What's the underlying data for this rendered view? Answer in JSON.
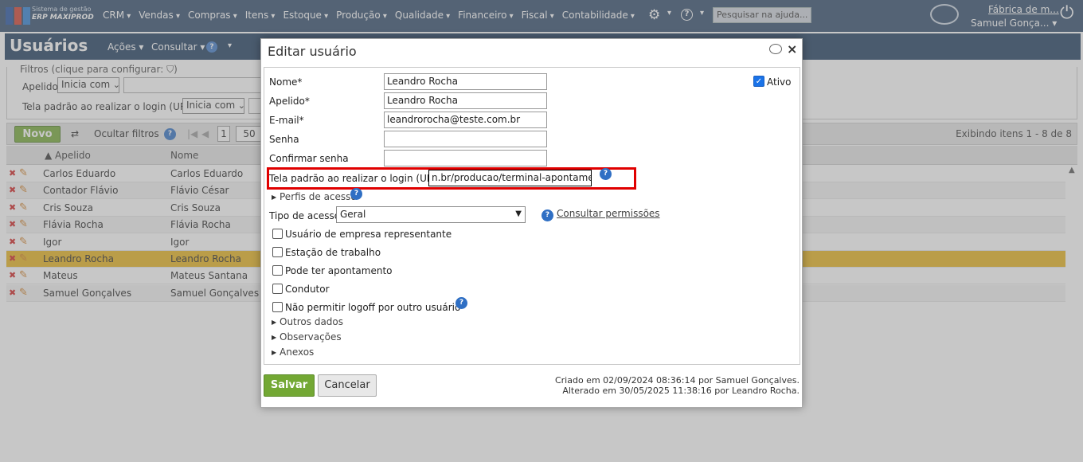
{
  "topbar": {
    "brand_line1": "Sistema de gestão",
    "brand_line2": "ERP MAXIPROD",
    "menu": [
      "CRM",
      "Vendas",
      "Compras",
      "Itens",
      "Estoque",
      "Produção",
      "Qualidade",
      "Financeiro",
      "Fiscal",
      "Contabilidade"
    ],
    "help_search_placeholder": "Pesquisar na ajuda...",
    "company": "Fábrica de m...",
    "user": "Samuel Gonça... ▾"
  },
  "subbar": {
    "title": "Usuários",
    "acoes": "Ações ▾",
    "consultar": "Consultar ▾"
  },
  "filters": {
    "legend": "Filtros (clique para configurar:",
    "apelido_label": "Apelido",
    "apelido_op": "Inicia com",
    "tela_label": "Tela padrão ao realizar o login (URL)",
    "tela_op": "Inicia com"
  },
  "toolbar": {
    "novo": "Novo",
    "ocultar": "Ocultar filtros",
    "page": "1",
    "page_size": "50",
    "exibindo": "Exibindo itens 1 - 8 de 8"
  },
  "grid": {
    "headers": [
      "▲ Apelido",
      "Nome"
    ],
    "rows": [
      [
        "Carlos Eduardo",
        "Carlos Eduardo"
      ],
      [
        "Contador Flávio",
        "Flávio César"
      ],
      [
        "Cris Souza",
        "Cris Souza"
      ],
      [
        "Flávia Rocha",
        "Flávia Rocha"
      ],
      [
        "Igor",
        "Igor"
      ],
      [
        "Leandro Rocha",
        "Leandro Rocha"
      ],
      [
        "Mateus",
        "Mateus Santana"
      ],
      [
        "Samuel Gonçalves",
        "Samuel Gonçalves"
      ]
    ],
    "selected_index": 5,
    "selected_color": "#e8b21a"
  },
  "dialog": {
    "title": "Editar usuário",
    "nome_label": "Nome*",
    "nome_value": "Leandro Rocha",
    "apelido_label": "Apelido*",
    "apelido_value": "Leandro Rocha",
    "email_label": "E-mail*",
    "email_value": "leandrorocha@teste.com.br",
    "senha_label": "Senha",
    "confirmar_label": "Confirmar senha",
    "ativo_label": "Ativo",
    "ativo_checked": true,
    "tela_label": "Tela padrão ao realizar o login (URL)",
    "tela_value": "n.br/producao/terminal-apontamento",
    "perfis": "Perfis de acesso",
    "tipo_label": "Tipo de acesso",
    "tipo_value": "Geral",
    "consultar_permissoes": "Consultar permissões",
    "checkboxes": [
      "Usuário de empresa representante",
      "Estação de trabalho",
      "Pode ter apontamento",
      "Condutor",
      "Não permitir logoff por outro usuário"
    ],
    "outros_dados": "Outros dados",
    "observacoes": "Observações",
    "anexos": "Anexos",
    "salvar": "Salvar",
    "cancelar": "Cancelar",
    "criado": "Criado em 02/09/2024 08:36:14 por Samuel Gonçalves.",
    "alterado": "Alterado em 30/05/2025 11:38:16 por Leandro Rocha."
  }
}
